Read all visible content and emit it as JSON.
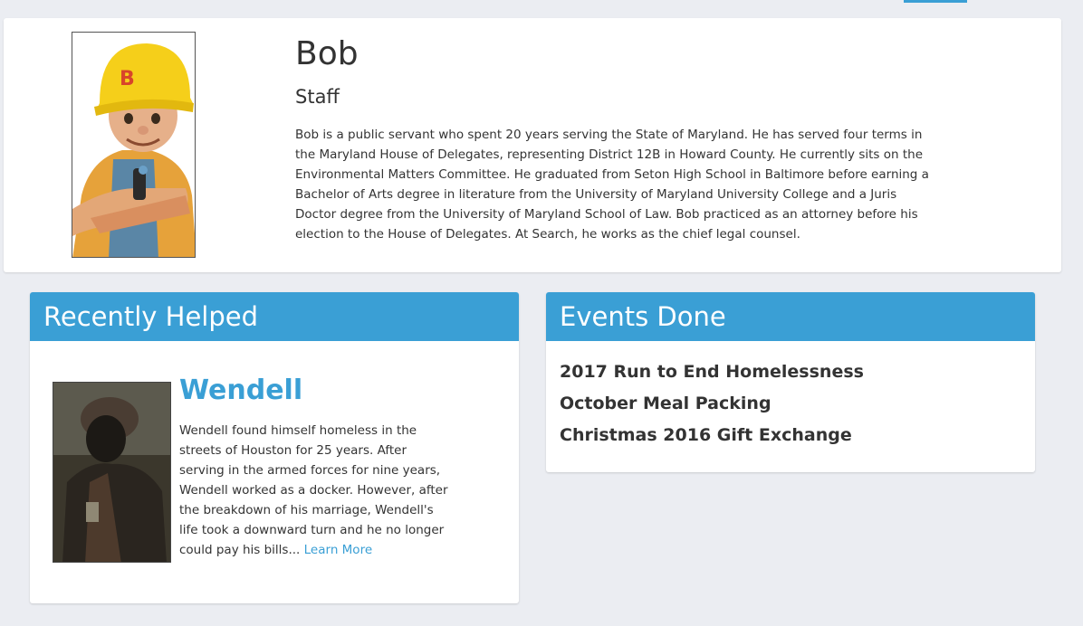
{
  "profile": {
    "name": "Bob",
    "role": "Staff",
    "bio": "Bob is a public servant who spent 20 years serving the State of Maryland. He has served four terms in the Maryland House of Delegates, representing District 12B in Howard County. He currently sits on the Environmental Matters Committee. He graduated from Seton High School in Baltimore before earning a Bachelor of Arts degree in literature from the University of Maryland University College and a Juris Doctor degree from the University of Maryland School of Law. Bob practiced as an attorney before his election to the House of Delegates. At Search, he works as the chief legal counsel.",
    "helmet_letter": "B"
  },
  "recently_helped": {
    "title": "Recently Helped",
    "name": "Wendell",
    "summary": "Wendell found himself homeless in the streets of Houston for 25 years. After serving in the armed forces for nine years, Wendell worked as a docker. However, after the breakdown of his marriage, Wendell's life took a downward turn and he no longer could pay his bills...",
    "learn_more": "Learn More"
  },
  "events_done": {
    "title": "Events Done",
    "items": [
      "2017 Run to End Homelessness",
      "October Meal Packing",
      "Christmas 2016 Gift Exchange"
    ]
  },
  "colors": {
    "accent": "#3a9fd5",
    "background": "#ebedf2",
    "text": "#333333"
  }
}
